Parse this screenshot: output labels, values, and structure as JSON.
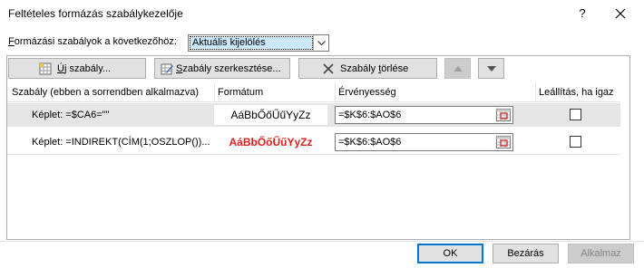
{
  "window": {
    "title": "Feltételes formázás szabálykezelője",
    "help_label": "?"
  },
  "show_rules": {
    "label_prefix": "F",
    "label_rest": "ormázási szabályok a következőhöz:",
    "selected": "Aktuális kijelölés"
  },
  "toolbar": {
    "new_rule_hotkey": "Ú",
    "new_rule_rest": "j szabály...",
    "edit_rule_pre": "S",
    "edit_rule_rest": "zabály szerkesztése...",
    "delete_rule_pre": "Szabály ",
    "delete_rule_hotkey": "t",
    "delete_rule_rest": "örlése"
  },
  "columns": {
    "rule": "Szabály (ebben a sorrendben alkalmazva)",
    "format": "Formátum",
    "applies_to": "Érvényesség",
    "stop_if_true": "Leállítás, ha igaz"
  },
  "rules": [
    {
      "rule": "Képlet: =$CA6=\"\"",
      "format_preview": "AáBbŐőŰűYyZz",
      "applies_to": "=$K$6:$AO$6",
      "stop_if_true": false
    },
    {
      "rule": "Képlet: =INDIREKT(CÍM(1;OSZLOP())...",
      "format_preview": "AáBbŐőŰűYyZz",
      "applies_to": "=$K$6:$AO$6",
      "stop_if_true": false
    }
  ],
  "footer": {
    "ok": "OK",
    "close": "Bezárás",
    "apply": "Alkalmaz"
  },
  "colors": {
    "selected_row": "#e5e5e5",
    "rule2_format": "#e0201e",
    "ok_border": "#0078d7"
  }
}
